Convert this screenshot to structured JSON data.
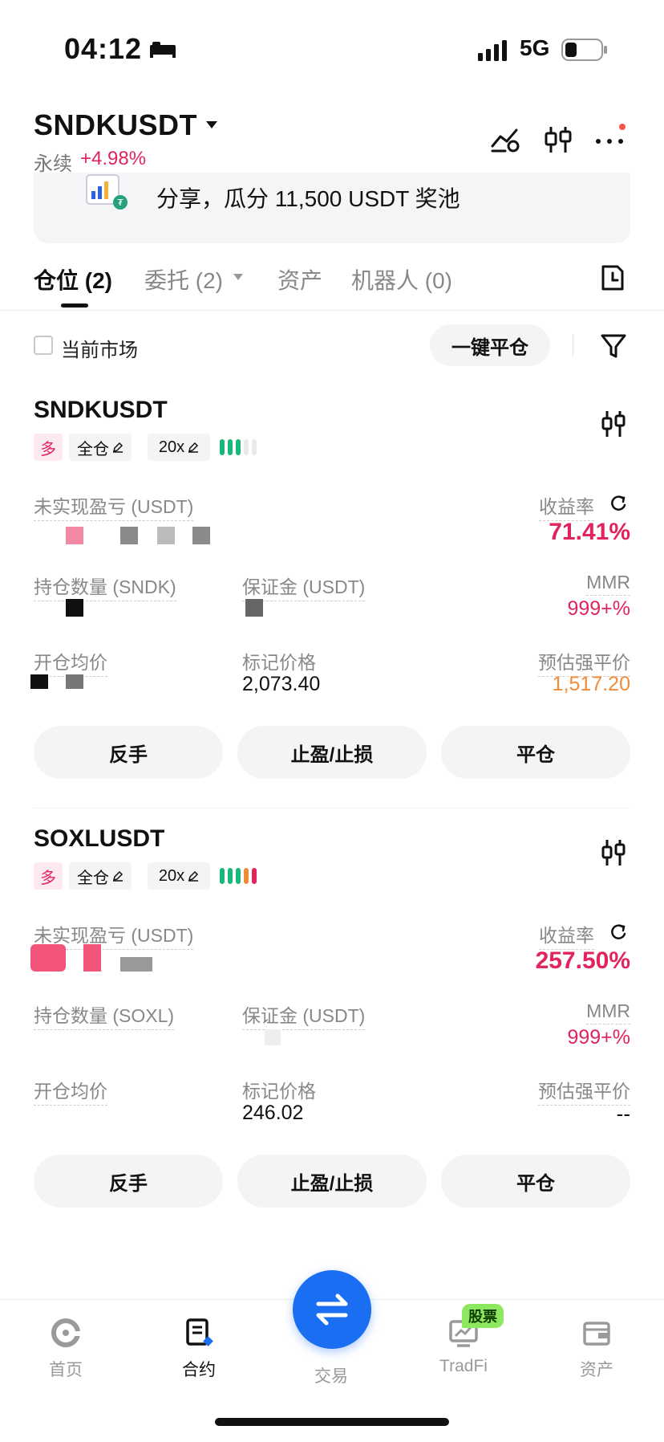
{
  "status_bar": {
    "time": "04:12",
    "network": "5G"
  },
  "header": {
    "symbol": "SNDKUSDT",
    "contract_type": "永续",
    "change_pct": "+4.98%"
  },
  "banner": {
    "text": "分享，瓜分 11,500 USDT 奖池"
  },
  "tabs": [
    {
      "label": "仓位 (2)",
      "active": true
    },
    {
      "label": "委托 (2)",
      "active": false
    },
    {
      "label": "资产",
      "active": false
    },
    {
      "label": "机器人 (0)",
      "active": false
    }
  ],
  "filter": {
    "current_market_label": "当前市场",
    "close_all_label": "一键平仓"
  },
  "positions": [
    {
      "symbol": "SNDKUSDT",
      "side": "多",
      "margin_mode": "全仓",
      "leverage": "20x",
      "risk_bars": [
        "#16b979",
        "#16b979",
        "#16b979",
        "#e9eaec",
        "#e9eaec"
      ],
      "unrealized_pnl_label": "未实现盈亏 (USDT)",
      "roe_label": "收益率",
      "roe_value": "71.41%",
      "qty_label": "持仓数量 (SNDK)",
      "margin_label": "保证金 (USDT)",
      "mmr_label": "MMR",
      "mmr_value": "999+%",
      "entry_label": "开仓均价",
      "mark_label": "标记价格",
      "mark_value": "2,073.40",
      "liq_label": "预估强平价",
      "liq_value": "1,517.20",
      "buttons": [
        "反手",
        "止盈/止损",
        "平仓"
      ]
    },
    {
      "symbol": "SOXLUSDT",
      "side": "多",
      "margin_mode": "全仓",
      "leverage": "20x",
      "risk_bars": [
        "#16b979",
        "#16b979",
        "#16b979",
        "#f08b3a",
        "#e0245e"
      ],
      "unrealized_pnl_label": "未实现盈亏 (USDT)",
      "roe_label": "收益率",
      "roe_value": "257.50%",
      "qty_label": "持仓数量 (SOXL)",
      "margin_label": "保证金 (USDT)",
      "mmr_label": "MMR",
      "mmr_value": "999+%",
      "entry_label": "开仓均价",
      "mark_label": "标记价格",
      "mark_value": "246.02",
      "liq_label": "预估强平价",
      "liq_value": "--",
      "buttons": [
        "反手",
        "止盈/止损",
        "平仓"
      ]
    }
  ],
  "bottom_nav": [
    {
      "label": "首页",
      "icon": "home-icon",
      "active": false
    },
    {
      "label": "合约",
      "icon": "contract-icon",
      "active": true
    },
    {
      "label": "交易",
      "icon": "swap-icon",
      "active": false
    },
    {
      "label": "TradFi",
      "icon": "tradfi-icon",
      "active": false,
      "badge": "股票"
    },
    {
      "label": "资产",
      "icon": "wallet-icon",
      "active": false
    }
  ],
  "colors": {
    "accent_pink": "#e0245e",
    "accent_blue": "#1a6ef2",
    "orange": "#f08b3a",
    "green": "#16b979"
  }
}
